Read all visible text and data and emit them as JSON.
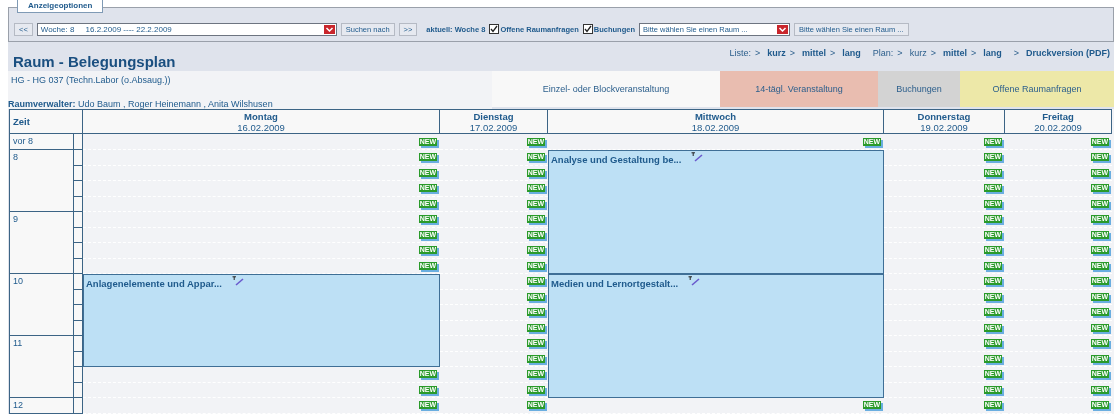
{
  "options_tab": {
    "label": "Anzeigeoptionen"
  },
  "controls": {
    "prev": "<<",
    "week_select": "Woche: 8     16.2.2009 ---- 22.2.2009",
    "search_button": "Suchen nach",
    "next": ">>",
    "current": "aktuell: Woche 8",
    "checkboxes": [
      {
        "label": "Offene Raumanfragen",
        "checked": true
      },
      {
        "label": "Buchungen",
        "checked": true
      }
    ],
    "room_select": "Bitte wählen Sie einen Raum ...",
    "room_button": "Bitte wählen Sie einen Raum ..."
  },
  "title": "Raum - Belegungsplan",
  "link_groups": [
    {
      "label": "Liste:",
      "links": [
        {
          "arrow": ">",
          "label": "kurz",
          "selected": false
        },
        {
          "arrow": ">",
          "label": "mittel",
          "selected": false
        },
        {
          "arrow": ">",
          "label": "lang",
          "selected": false
        }
      ]
    },
    {
      "label": "Plan:",
      "links": [
        {
          "arrow": ">",
          "label": "kurz",
          "selected": true
        },
        {
          "arrow": ">",
          "label": "mittel",
          "selected": false
        },
        {
          "arrow": ">",
          "label": "lang",
          "selected": false
        }
      ]
    },
    {
      "links": [
        {
          "arrow": ">",
          "label": "Druckversion (PDF)",
          "selected": false
        }
      ]
    }
  ],
  "room": "HG - HG 037 (Techn.Labor (o.Absaug.))",
  "managers": "**Raumverwalter:** Udo Baum , Roger Heinemann , Anita Wilshusen",
  "legend": [
    {
      "label": "Einzel- oder Blockveranstaltung",
      "color": "#f8f8f8"
    },
    {
      "label": "14-tägl. Veranstaltung",
      "color": "#e9bdb0"
    },
    {
      "label": "Buchungen",
      "color": "#d3d3d3"
    },
    {
      "label": "Offene Raumanfragen",
      "color": "#ede8a8"
    }
  ],
  "time_header": "Zeit",
  "time_rows": [
    {
      "kind": "before",
      "label": "vor 8"
    },
    {
      "kind": "hour",
      "label": "8"
    },
    {
      "kind": "hour",
      "label": "9"
    },
    {
      "kind": "hour",
      "label": "10"
    },
    {
      "kind": "hour",
      "label": "11"
    },
    {
      "kind": "hour",
      "label": "12"
    }
  ],
  "days": [
    {
      "name": "Montag",
      "date": "16.02.2009",
      "cells": [
        {
          "kind": "free",
          "badge": "NEW"
        },
        {
          "kind": "free",
          "badge": "NEW"
        },
        {
          "kind": "free",
          "badge": "NEW"
        },
        {
          "kind": "free",
          "badge": "NEW"
        },
        {
          "kind": "free",
          "badge": "NEW"
        },
        {
          "kind": "free",
          "badge": "NEW"
        },
        {
          "kind": "free",
          "badge": "NEW"
        },
        {
          "kind": "free",
          "badge": "NEW"
        },
        {
          "kind": "free",
          "badge": "NEW"
        },
        {
          "kind": "event",
          "title": "Anlagenelemente und Appar..."
        },
        {
          "kind": "continued"
        },
        {
          "kind": "continued"
        },
        {
          "kind": "continued"
        },
        {
          "kind": "continued"
        },
        {
          "kind": "continued"
        },
        {
          "kind": "free",
          "badge": "NEW"
        },
        {
          "kind": "free",
          "badge": "NEW"
        },
        {
          "kind": "free",
          "badge": "NEW"
        }
      ]
    },
    {
      "name": "Dienstag",
      "date": "17.02.2009",
      "cells": [
        {
          "kind": "free",
          "badge": "NEW"
        },
        {
          "kind": "free",
          "badge": "NEW"
        },
        {
          "kind": "free",
          "badge": "NEW"
        },
        {
          "kind": "free",
          "badge": "NEW"
        },
        {
          "kind": "free",
          "badge": "NEW"
        },
        {
          "kind": "free",
          "badge": "NEW"
        },
        {
          "kind": "free",
          "badge": "NEW"
        },
        {
          "kind": "free",
          "badge": "NEW"
        },
        {
          "kind": "free",
          "badge": "NEW"
        },
        {
          "kind": "free",
          "badge": "NEW"
        },
        {
          "kind": "free",
          "badge": "NEW"
        },
        {
          "kind": "free",
          "badge": "NEW"
        },
        {
          "kind": "free",
          "badge": "NEW"
        },
        {
          "kind": "free",
          "badge": "NEW"
        },
        {
          "kind": "free",
          "badge": "NEW"
        },
        {
          "kind": "free",
          "badge": "NEW"
        },
        {
          "kind": "free",
          "badge": "NEW"
        },
        {
          "kind": "free",
          "badge": "NEW"
        }
      ]
    },
    {
      "name": "Mittwoch",
      "date": "18.02.2009",
      "cells": [
        {
          "kind": "free",
          "badge": "NEW"
        },
        {
          "kind": "event",
          "title": "Analyse und Gestaltung be..."
        },
        {
          "kind": "continued"
        },
        {
          "kind": "continued"
        },
        {
          "kind": "continued"
        },
        {
          "kind": "continued"
        },
        {
          "kind": "continued"
        },
        {
          "kind": "continued"
        },
        {
          "kind": "continued"
        },
        {
          "kind": "event",
          "title": "Medien und Lernortgestalt..."
        },
        {
          "kind": "continued"
        },
        {
          "kind": "continued"
        },
        {
          "kind": "continued"
        },
        {
          "kind": "continued"
        },
        {
          "kind": "continued"
        },
        {
          "kind": "continued"
        },
        {
          "kind": "continued"
        },
        {
          "kind": "free",
          "badge": "NEW"
        }
      ]
    },
    {
      "name": "Donnerstag",
      "date": "19.02.2009",
      "cells": [
        {
          "kind": "free",
          "badge": "NEW"
        },
        {
          "kind": "free",
          "badge": "NEW"
        },
        {
          "kind": "free",
          "badge": "NEW"
        },
        {
          "kind": "free",
          "badge": "NEW"
        },
        {
          "kind": "free",
          "badge": "NEW"
        },
        {
          "kind": "free",
          "badge": "NEW"
        },
        {
          "kind": "free",
          "badge": "NEW"
        },
        {
          "kind": "free",
          "badge": "NEW"
        },
        {
          "kind": "free",
          "badge": "NEW"
        },
        {
          "kind": "free",
          "badge": "NEW"
        },
        {
          "kind": "free",
          "badge": "NEW"
        },
        {
          "kind": "free",
          "badge": "NEW"
        },
        {
          "kind": "free",
          "badge": "NEW"
        },
        {
          "kind": "free",
          "badge": "NEW"
        },
        {
          "kind": "free",
          "badge": "NEW"
        },
        {
          "kind": "free",
          "badge": "NEW"
        },
        {
          "kind": "free",
          "badge": "NEW"
        },
        {
          "kind": "free",
          "badge": "NEW"
        }
      ]
    },
    {
      "name": "Freitag",
      "date": "20.02.2009",
      "cells": [
        {
          "kind": "free",
          "badge": "NEW"
        },
        {
          "kind": "free",
          "badge": "NEW"
        },
        {
          "kind": "free",
          "badge": "NEW"
        },
        {
          "kind": "free",
          "badge": "NEW"
        },
        {
          "kind": "free",
          "badge": "NEW"
        },
        {
          "kind": "free",
          "badge": "NEW"
        },
        {
          "kind": "free",
          "badge": "NEW"
        },
        {
          "kind": "free",
          "badge": "NEW"
        },
        {
          "kind": "free",
          "badge": "NEW"
        },
        {
          "kind": "free",
          "badge": "NEW"
        },
        {
          "kind": "free",
          "badge": "NEW"
        },
        {
          "kind": "free",
          "badge": "NEW"
        },
        {
          "kind": "free",
          "badge": "NEW"
        },
        {
          "kind": "free",
          "badge": "NEW"
        },
        {
          "kind": "free",
          "badge": "NEW"
        },
        {
          "kind": "free",
          "badge": "NEW"
        },
        {
          "kind": "free",
          "badge": "NEW"
        },
        {
          "kind": "free",
          "badge": "NEW"
        }
      ]
    }
  ]
}
